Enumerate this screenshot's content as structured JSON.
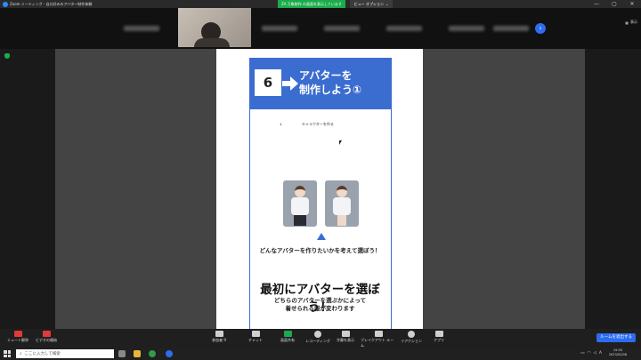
{
  "titlebar": {
    "app_title": "Zoom ミーティング - 自分好みのアバター制作体験",
    "share_notice": "ZA 万象制作 の画面を表示しています",
    "view_options": "ビュー オプション",
    "minimize": "—",
    "maximize": "▢",
    "close": "✕"
  },
  "participant_strip": {
    "show_label": "表示",
    "next_icon": "chevron-right-icon"
  },
  "slide": {
    "step_number": "6",
    "header_line1": "アバターを",
    "header_line2": "制作しよう①",
    "nav_back": "‹",
    "nav_title": "キャラクターを作る",
    "question": "どんなアバターを作りたいかを考えて選ぼう！",
    "headline": "最初にアバターを選ぼう！",
    "sub_line1": "どちらのアバターを選ぶかによって",
    "sub_line2": "着せられる服が変わります",
    "accent_color": "#3b6cd0"
  },
  "toolbar": {
    "mute": "ミュート解除",
    "video": "ビデオの開始",
    "participants": "参加者",
    "participant_count": "9",
    "chat": "チャット",
    "share": "画面共有",
    "record": "レコーディング",
    "captions": "字幕を表示",
    "breakout": "ブレイクアウト ルーム",
    "reactions": "リアクション",
    "apps": "アプリ",
    "leave": "ルームを退出する"
  },
  "taskbar": {
    "search_placeholder": "ここに入力して検索",
    "time": "15:50",
    "date": "2023/02/08",
    "ime": "A"
  }
}
